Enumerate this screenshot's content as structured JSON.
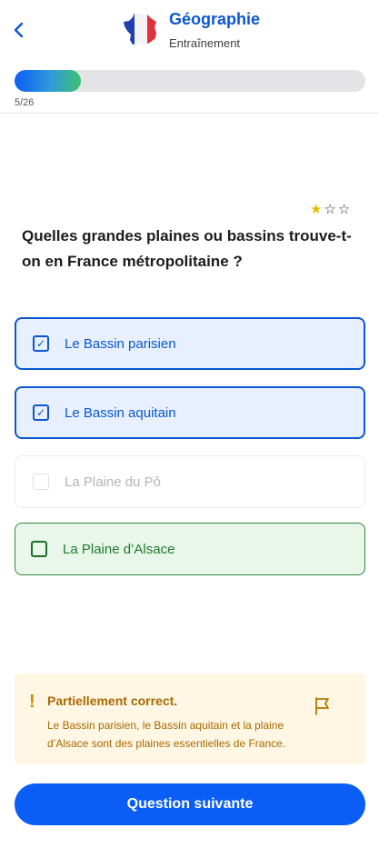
{
  "header": {
    "title": "Géographie",
    "subtitle": "Entraînement",
    "logo_icon": "france-flag-map-icon",
    "back_icon": "chevron-left-icon"
  },
  "progress": {
    "current": 5,
    "total": 26,
    "text": "5/26",
    "fraction": 0.19
  },
  "difficulty": {
    "filled": 1,
    "total": 3,
    "stars": [
      "★",
      "☆",
      "☆"
    ]
  },
  "question": {
    "text": "Quelles grandes plaines ou bassins trouve-t-on en France métropolitaine ?"
  },
  "options": [
    {
      "label": "Le Bassin parisien",
      "state": "selected",
      "check": "✓"
    },
    {
      "label": "Le Bassin aquitain",
      "state": "selected",
      "check": "✓"
    },
    {
      "label": "La Plaine du Pô",
      "state": "disabled",
      "check": ""
    },
    {
      "label": "La Plaine d’Alsace",
      "state": "correct-missed",
      "check": ""
    }
  ],
  "feedback": {
    "icon": "!",
    "title": "Partiellement correct.",
    "text": "Le Bassin parisien, le Bassin aquitain et la plaine d’Alsace sont des plaines essentielles de France.",
    "report_icon": "flag-icon"
  },
  "cta": {
    "label": "Question suivante"
  },
  "colors": {
    "accent": "#0b57d0",
    "button": "#0b5ef5",
    "correct": "#1f7a2a",
    "warning": "#a86a00"
  }
}
